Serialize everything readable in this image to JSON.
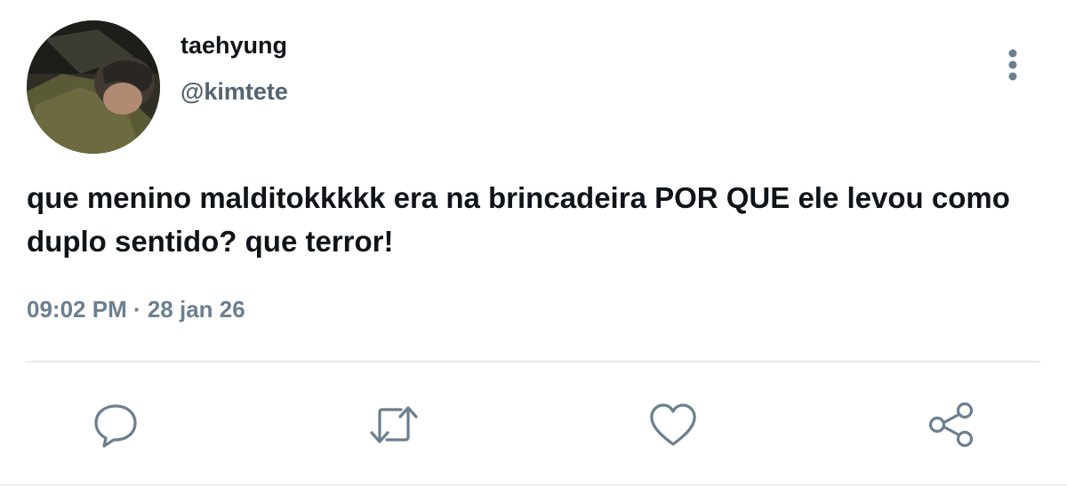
{
  "author": {
    "display_name": "taehyung",
    "handle": "@kimtete",
    "avatar_icon": "profile-photo"
  },
  "tweet": {
    "text": "que menino malditokkkkk era na brincadeira POR QUE ele levou como duplo sentido? que terror!",
    "timestamp": "09:02 PM · 28 jan 26"
  },
  "actions": {
    "reply_icon": "speech-bubble-icon",
    "retweet_icon": "retweet-icon",
    "like_icon": "heart-icon",
    "share_icon": "share-icon"
  },
  "colors": {
    "text": "#0f1419",
    "secondary": "#536471",
    "icon": "#6b7f8f",
    "divider": "#e6e9eb"
  }
}
